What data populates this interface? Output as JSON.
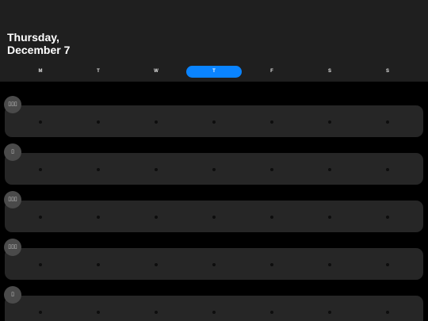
{
  "header": {
    "title_line1": "Thursday,",
    "title_line2": "December 7"
  },
  "weekdays": [
    {
      "label": "M",
      "active": false
    },
    {
      "label": "T",
      "active": false
    },
    {
      "label": "W",
      "active": false
    },
    {
      "label": "T",
      "active": true
    },
    {
      "label": "F",
      "active": false
    },
    {
      "label": "S",
      "active": false
    },
    {
      "label": "S",
      "active": false
    }
  ],
  "colors": {
    "accent": "#0a84ff",
    "header_bg": "#1f1f1f",
    "card_bg": "#262626",
    "badge_bg": "#4a4a4a",
    "page_bg": "#000000"
  },
  "habits": [
    {
      "icon": "emoji-icon",
      "glyph": "▯▯▯"
    },
    {
      "icon": "emoji-icon",
      "glyph": "▯"
    },
    {
      "icon": "emoji-icon",
      "glyph": "▯▯▯"
    },
    {
      "icon": "emoji-icon",
      "glyph": "▯▯▯"
    },
    {
      "icon": "emoji-icon",
      "glyph": "▯"
    }
  ]
}
